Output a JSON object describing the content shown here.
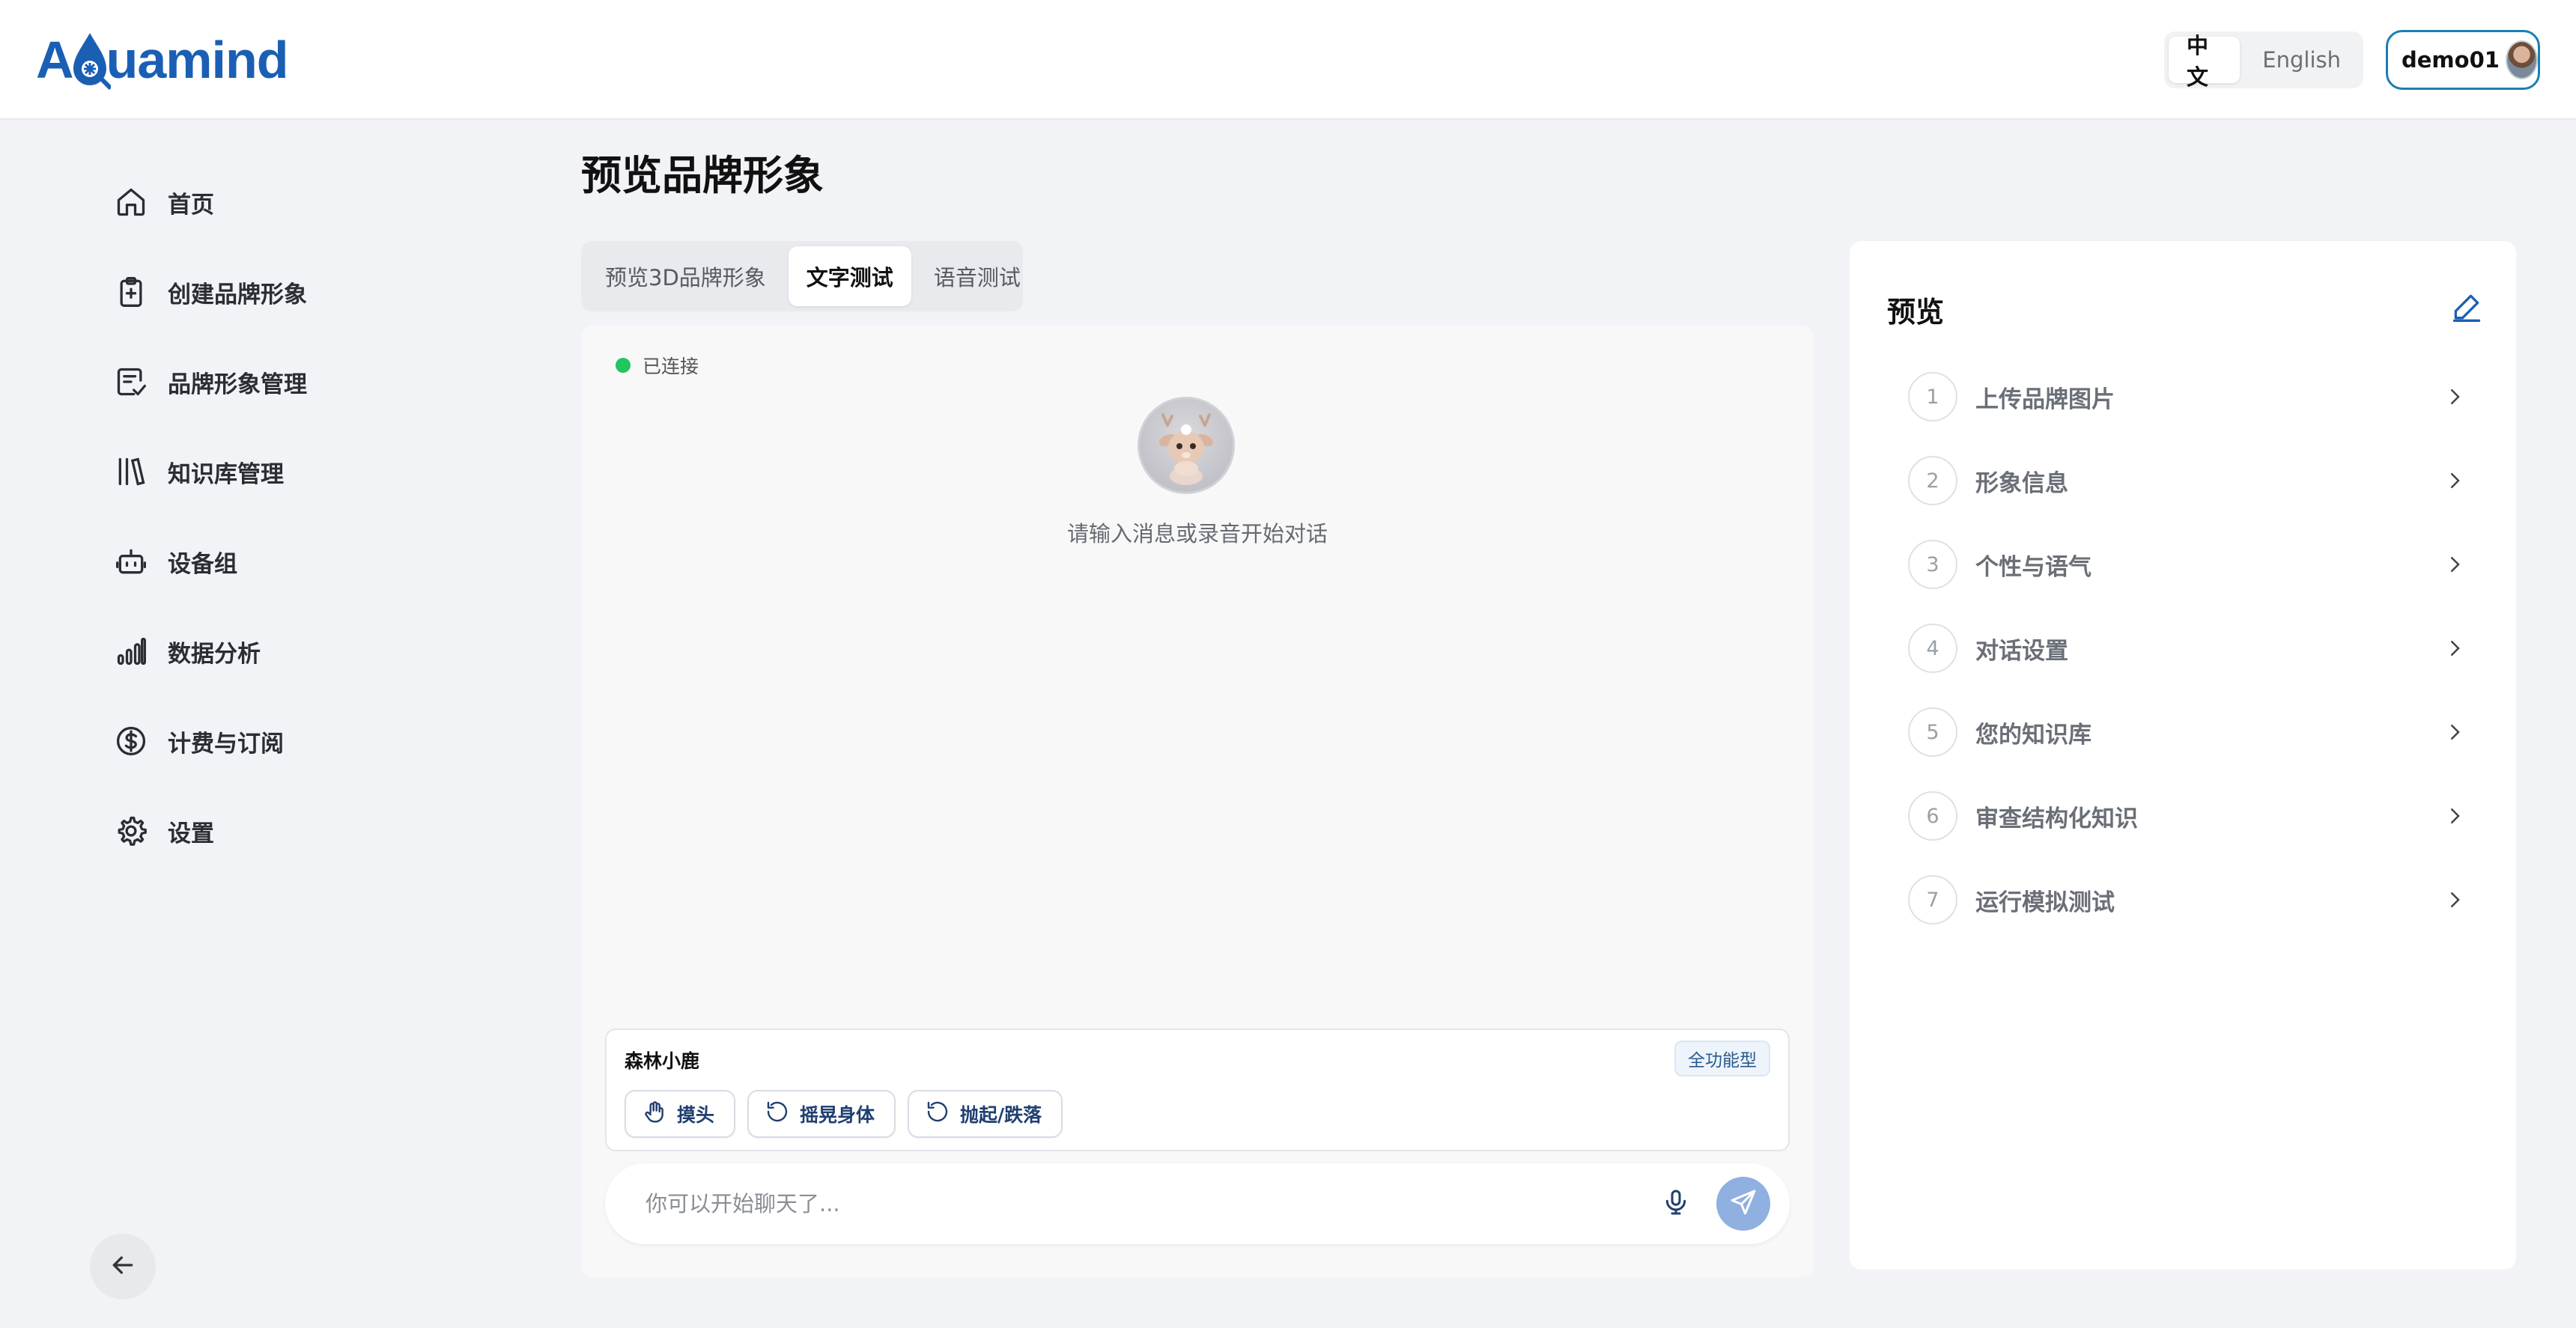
{
  "header": {
    "logo_text_left": "A",
    "logo_text_right": "uamind",
    "lang_options": [
      "中文",
      "English"
    ],
    "lang_selected": "中文",
    "username": "demo01"
  },
  "sidebar": {
    "items": [
      {
        "label": "首页",
        "icon": "home-icon"
      },
      {
        "label": "创建品牌形象",
        "icon": "clipboard-plus-icon"
      },
      {
        "label": "品牌形象管理",
        "icon": "clipboard-check-icon"
      },
      {
        "label": "知识库管理",
        "icon": "library-icon"
      },
      {
        "label": "设备组",
        "icon": "robot-icon"
      },
      {
        "label": "数据分析",
        "icon": "bar-chart-icon"
      },
      {
        "label": "计费与订阅",
        "icon": "dollar-circle-icon"
      },
      {
        "label": "设置",
        "icon": "gear-icon"
      }
    ],
    "collapse_icon": "arrow-left-icon"
  },
  "main": {
    "title": "预览品牌形象",
    "tabs": [
      {
        "label": "预览3D品牌形象"
      },
      {
        "label": "文字测试"
      },
      {
        "label": "语音测试"
      }
    ],
    "active_tab": "文字测试",
    "chat": {
      "status_text": "已连接",
      "status_color": "#22c55e",
      "welcome_text": "请输入消息或录音开始对话",
      "agent_name": "森林小鹿",
      "agent_badge": "全功能型",
      "actions": [
        {
          "label": "摸头",
          "icon": "hand-icon"
        },
        {
          "label": "摇晃身体",
          "icon": "rotate-icon"
        },
        {
          "label": "抛起/跌落",
          "icon": "rotate-icon"
        }
      ],
      "input_placeholder": "你可以开始聊天了...",
      "input_value": ""
    }
  },
  "preview": {
    "title": "预览",
    "steps": [
      {
        "num": "1",
        "label": "上传品牌图片"
      },
      {
        "num": "2",
        "label": "形象信息"
      },
      {
        "num": "3",
        "label": "个性与语气"
      },
      {
        "num": "4",
        "label": "对话设置"
      },
      {
        "num": "5",
        "label": "您的知识库"
      },
      {
        "num": "6",
        "label": "审查结构化知识"
      },
      {
        "num": "7",
        "label": "运行模拟测试"
      }
    ]
  },
  "colors": {
    "brand": "#1a5fb4",
    "accent": "#1a7fb4",
    "send_button": "#8fb0e0"
  }
}
